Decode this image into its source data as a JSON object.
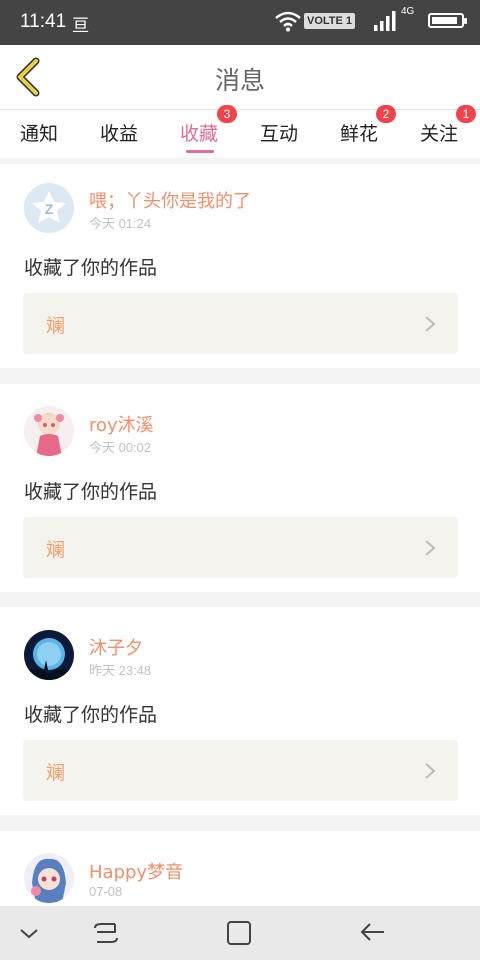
{
  "status_bar": {
    "time": "11:41",
    "notification_glyph": "亘",
    "volte_label": "VOLTE 1",
    "network_type": "4G",
    "battery_level": 0.9
  },
  "header": {
    "title": "消息",
    "back_icon": "chevron-left-icon",
    "back_color": "#e8d24a"
  },
  "tabs": [
    {
      "label": "通知",
      "badge": null,
      "active": false
    },
    {
      "label": "收益",
      "badge": null,
      "active": false
    },
    {
      "label": "收藏",
      "badge": "3",
      "active": true
    },
    {
      "label": "互动",
      "badge": null,
      "active": false
    },
    {
      "label": "鲜花",
      "badge": "2",
      "active": false
    },
    {
      "label": "关注",
      "badge": "1",
      "active": false
    }
  ],
  "colors": {
    "accent": "#e06d9b",
    "username": "#f0906e",
    "badge": "#f1434b"
  },
  "feed": [
    {
      "username": "喂；丫头你是我的了",
      "time": "今天 01:24",
      "action": "收藏了你的作品",
      "work_title": "斓",
      "avatar": "default-avatar-icon"
    },
    {
      "username": "roy沐溪",
      "time": "今天 00:02",
      "action": "收藏了你的作品",
      "work_title": "斓",
      "avatar": "anime-girl-avatar"
    },
    {
      "username": "沐子夕",
      "time": "昨天 23:48",
      "action": "收藏了你的作品",
      "work_title": "斓",
      "avatar": "moon-night-avatar"
    },
    {
      "username": "Happy梦音",
      "time": "07-08",
      "action": "",
      "work_title": "",
      "avatar": "anime-avatar"
    }
  ],
  "nav_bar": {
    "icons": [
      "chevron-down-icon",
      "recents-icon",
      "home-icon",
      "back-arrow-icon"
    ]
  }
}
